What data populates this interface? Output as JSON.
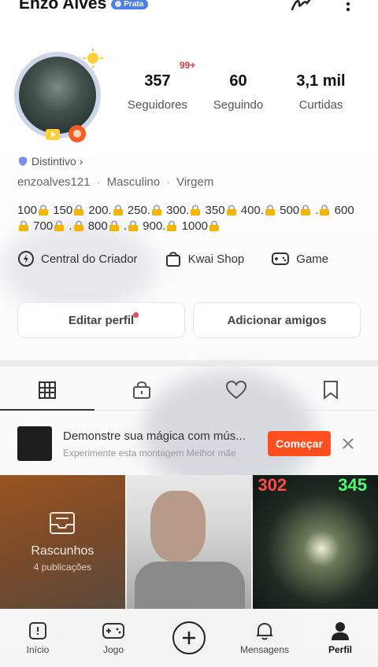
{
  "profile": {
    "name": "Enzo Alves",
    "tier_badge": "Prata",
    "distintivo": "Distintivo",
    "username": "enzoalves121",
    "gender": "Masculino",
    "sign": "Virgem",
    "notification_count": "99+"
  },
  "stats": [
    {
      "value": "357",
      "label": "Seguidores"
    },
    {
      "value": "60",
      "label": "Seguindo"
    },
    {
      "value": "3,1 mil",
      "label": "Curtidas"
    }
  ],
  "bio_numbers": [
    "100",
    "150",
    "200.",
    "250.",
    "300.",
    "350",
    "400.",
    "500",
    ".",
    "600",
    "700",
    ".",
    "800",
    ".",
    "900.",
    "1000"
  ],
  "shortcuts": [
    {
      "label": "Central do Criador",
      "icon": "lightning-icon"
    },
    {
      "label": "Kwai Shop",
      "icon": "shopping-bag-icon"
    },
    {
      "label": "Game",
      "icon": "gamepad-icon"
    }
  ],
  "buttons": {
    "edit": "Editar perfil",
    "add_friends": "Adicionar amigos"
  },
  "tabs": [
    "grid-icon",
    "lock-icon",
    "heart-icon",
    "bookmark-icon"
  ],
  "promo": {
    "title": "Demonstre sua mágica com mús...",
    "subtitle": "Experimente esta montagem Melhor mãe",
    "cta": "Começar"
  },
  "grid": {
    "drafts_title": "Rascunhos",
    "drafts_count": "4 publicações",
    "score_left": "302",
    "score_right": "345"
  },
  "nav": [
    {
      "label": "Início",
      "icon": "home-icon"
    },
    {
      "label": "Jogo",
      "icon": "gamepad-icon"
    },
    {
      "label": "",
      "icon": "plus-icon"
    },
    {
      "label": "Mensagens",
      "icon": "bell-icon"
    },
    {
      "label": "Perfil",
      "icon": "person-icon"
    }
  ]
}
